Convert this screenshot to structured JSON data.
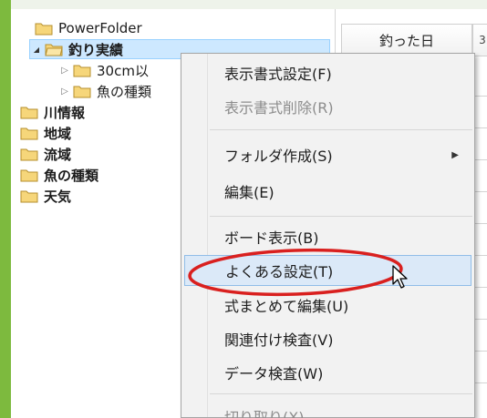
{
  "tree": {
    "items": [
      {
        "label": "PowerFolder",
        "bold": false,
        "expander": "",
        "level": 0,
        "selected": false
      },
      {
        "label": "釣り実績",
        "bold": true,
        "expander": "◢",
        "level": 0,
        "selected": true
      },
      {
        "label": "30cm以",
        "bold": false,
        "expander": "▷",
        "level": 1,
        "selected": false
      },
      {
        "label": "魚の種類",
        "bold": false,
        "expander": "▷",
        "level": 1,
        "selected": false
      },
      {
        "label": "川情報",
        "bold": true,
        "expander": "",
        "level": 0,
        "selected": false
      },
      {
        "label": "地域",
        "bold": true,
        "expander": "",
        "level": 0,
        "selected": false
      },
      {
        "label": "流域",
        "bold": true,
        "expander": "",
        "level": 0,
        "selected": false
      },
      {
        "label": "魚の種類",
        "bold": true,
        "expander": "",
        "level": 0,
        "selected": false
      },
      {
        "label": "天気",
        "bold": true,
        "expander": "",
        "level": 0,
        "selected": false
      }
    ]
  },
  "grid": {
    "column_header": "釣った日",
    "column_header2": "3"
  },
  "menu": {
    "items": [
      {
        "label": "表示書式設定(F)",
        "disabled": false
      },
      {
        "label": "表示書式削除(R)",
        "disabled": true
      },
      {
        "label": "フォルダ作成(S)",
        "disabled": false,
        "submenu": true
      },
      {
        "label": "編集(E)",
        "disabled": false
      },
      {
        "label": "ボード表示(B)",
        "disabled": false
      },
      {
        "label": "よくある設定(T)",
        "disabled": false,
        "hover": true
      },
      {
        "label": "式まとめて編集(U)",
        "disabled": false
      },
      {
        "label": "関連付け検査(V)",
        "disabled": false
      },
      {
        "label": "データ検査(W)",
        "disabled": false
      },
      {
        "label": "切り取り(X)",
        "disabled": true
      }
    ],
    "submenu_arrow": "▶"
  },
  "colors": {
    "frame_green": "#7dba3e",
    "selection": "#cde8ff",
    "menu_hover": "#dbe9f8",
    "annotation_red": "#d9201f",
    "folder_yellow": "#f6d67a"
  }
}
